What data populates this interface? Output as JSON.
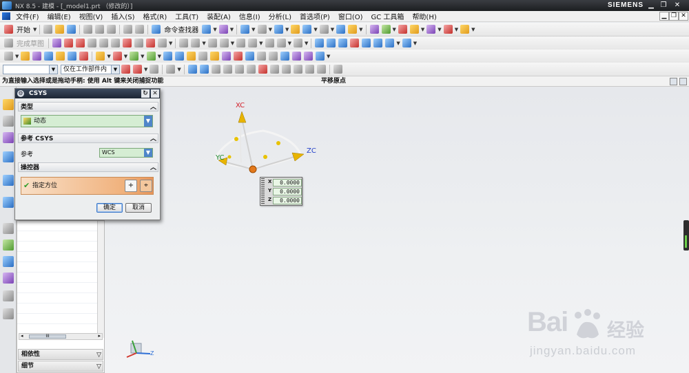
{
  "window": {
    "title": "NX 8.5 - 建模 - [_model1.prt （修改的）]",
    "brand": "SIEMENS"
  },
  "menu": {
    "items": [
      "文件(F)",
      "编辑(E)",
      "视图(V)",
      "插入(S)",
      "格式(R)",
      "工具(T)",
      "装配(A)",
      "信息(I)",
      "分析(L)",
      "首选项(P)",
      "窗口(O)",
      "GC 工具箱",
      "帮助(H)"
    ]
  },
  "toolbar1": {
    "start_label": "开始",
    "command_finder_label": "命令查找器"
  },
  "toolbar2": {
    "finish_sketch_label": "完成草图"
  },
  "selectionbar": {
    "filter_value": "",
    "scope_value": "仅在工作部件内"
  },
  "cue": {
    "message": "为直接输入选择或是拖动手柄: 使用 Alt 键来关闭捕捉功能",
    "status": "平移原点"
  },
  "dialog": {
    "title": "CSYS",
    "type_section": "类型",
    "type_value": "动态",
    "ref_section": "参考 CSYS",
    "ref_label": "参考",
    "ref_value": "WCS",
    "manip_section": "操控器",
    "specify_orient_label": "指定方位",
    "ok_label": "确定",
    "cancel_label": "取消"
  },
  "navigator": {
    "dependencies_label": "相依性",
    "details_label": "细节",
    "scroll_thumb": "III"
  },
  "manipulator": {
    "x_label": "XC",
    "y_label": "YC",
    "z_label": "ZC"
  },
  "coord_box": {
    "x_label": "X",
    "y_label": "Y",
    "z_label": "Z",
    "x_value": "0.0000",
    "y_value": "0.0000",
    "z_value": "0.0000"
  },
  "triad": {
    "z_label": "Z"
  },
  "watermark": {
    "brand": "Bai",
    "brand_cn": "经验",
    "url": "jingyan.baidu.com"
  }
}
